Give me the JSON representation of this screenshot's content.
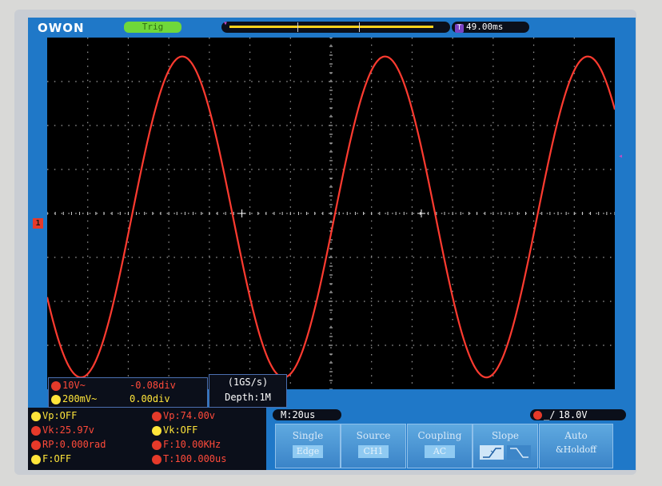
{
  "brand": {
    "logo": "OWON"
  },
  "top_bar": {
    "trigger_status": "Trig",
    "horizontal_position": "49.00ms"
  },
  "markers": {
    "ch1": "1"
  },
  "channels": [
    {
      "id": "1",
      "scale": "10V~",
      "offset": "-0.08div",
      "color": "#ff4a3a"
    },
    {
      "id": "2",
      "scale": "200mV~",
      "offset": "0.00div",
      "color": "#ffe53a"
    }
  ],
  "acquisition": {
    "sample_rate": "(1GS/s)",
    "depth": "Depth:1M"
  },
  "measurements": {
    "vp_ch2": "Vp:OFF",
    "vp_ch1": "Vp:74.00v",
    "vk_ch1": "Vk:25.97v",
    "vk_ch2": "Vk:OFF",
    "rp_ch1": "RP:0.000rad",
    "f_ch1": "F:10.00KHz",
    "f_ch2": "F:OFF",
    "t_ch1": "T:100.000us"
  },
  "timebase": "M:20us",
  "trigger_readout": "18.0V",
  "menu": {
    "single": {
      "title": "Single",
      "value": "Edge"
    },
    "source": {
      "title": "Source",
      "value": "CH1"
    },
    "coupling": {
      "title": "Coupling",
      "value": "AC"
    },
    "slope": {
      "title": "Slope"
    },
    "auto": {
      "title": "Auto",
      "value": "&Holdoff"
    }
  },
  "waveform": {
    "channel": "CH1",
    "frequency_khz": 10,
    "timebase_us_per_div": 20,
    "amplitude_div": 3.65,
    "offset_div": -0.08,
    "phase_deg": 30,
    "color": "#ff3b30"
  },
  "colors": {
    "screen_bg": "#1f78c8",
    "grid_bg": "#000000",
    "ch1": "#ff4a3a",
    "ch2": "#ffe53a",
    "trigger_marker": "#c24cc4"
  }
}
